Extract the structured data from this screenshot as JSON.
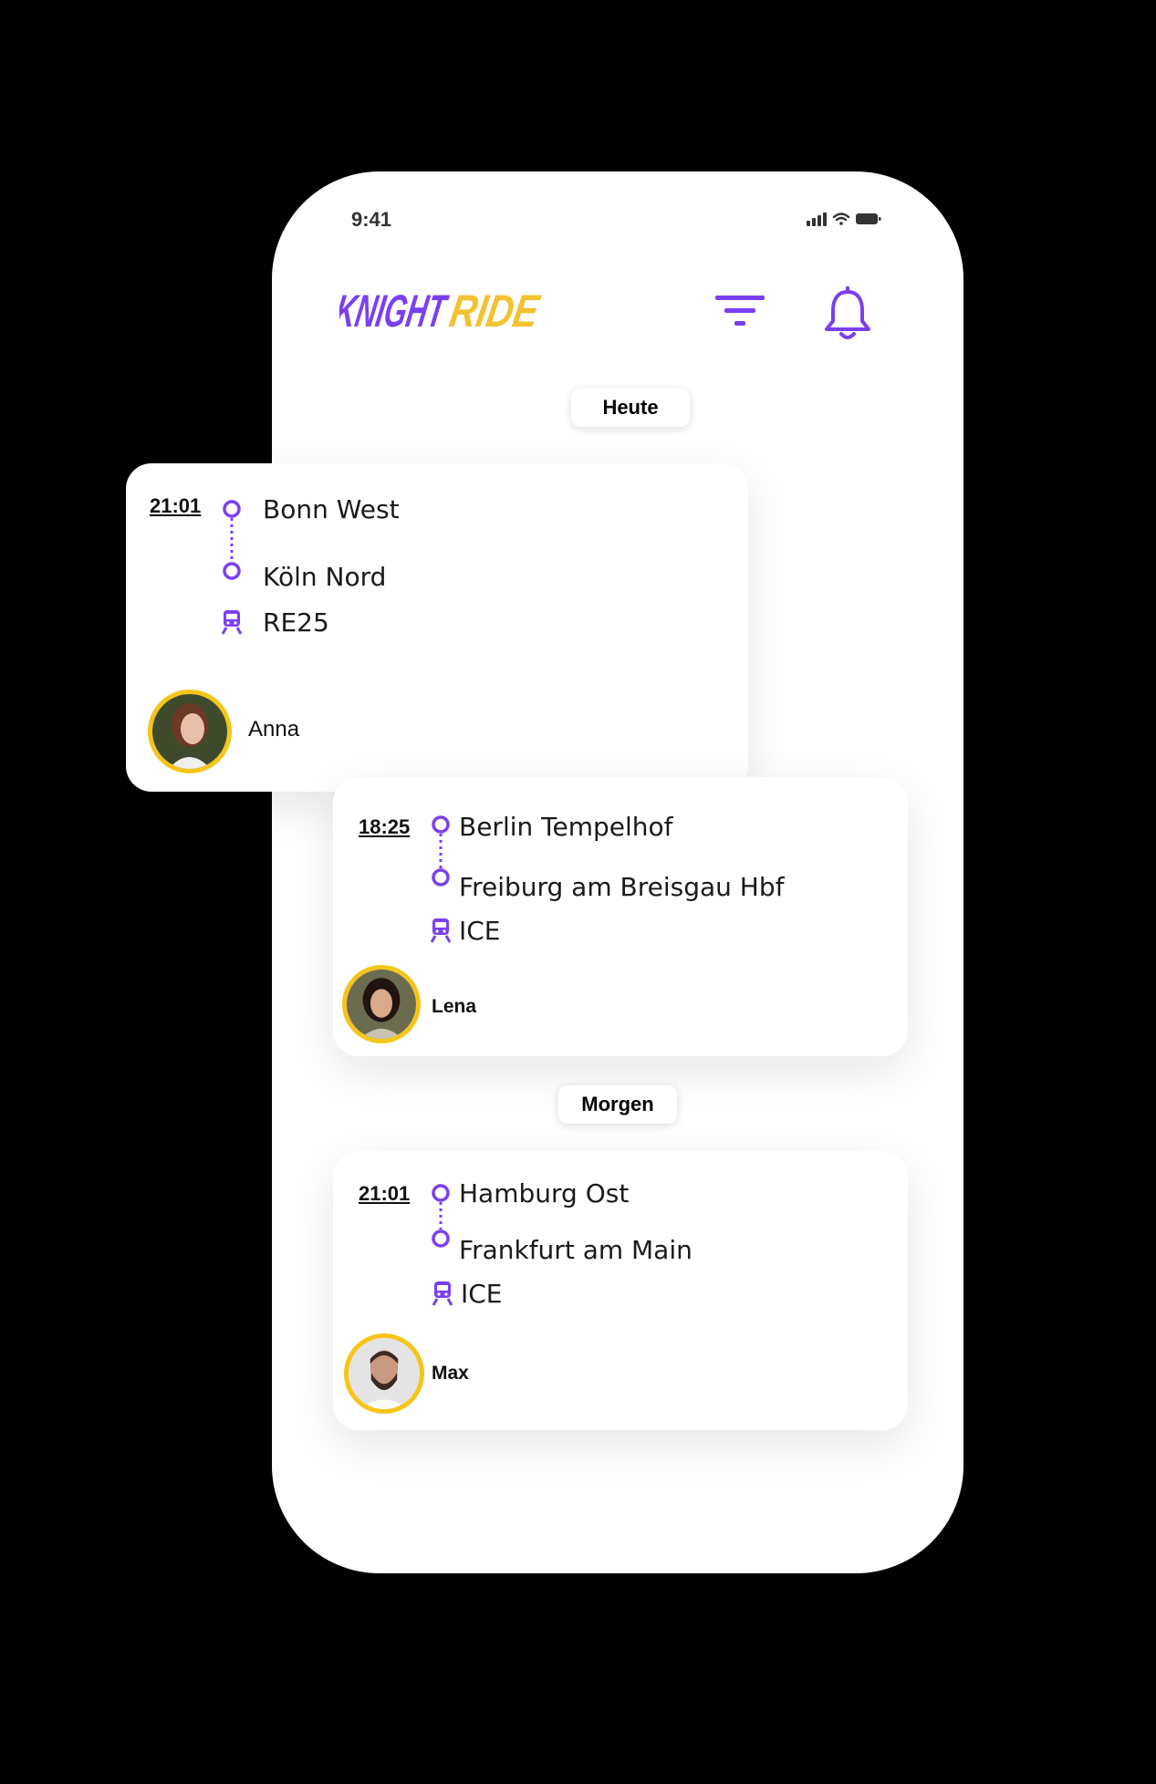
{
  "status_bar": {
    "time": "9:41"
  },
  "header": {
    "logo_text": "KNIGHTRIDE",
    "filter_icon": "filter-icon",
    "notification_icon": "bell-icon"
  },
  "colors": {
    "accent": "#7b3ff2",
    "gold": "#f5c518",
    "logo_yellow": "#f2c230"
  },
  "sections": {
    "today": "Heute",
    "tomorrow": "Morgen"
  },
  "rides": [
    {
      "time": "21:01",
      "from": "Bonn West",
      "to": "Köln Nord",
      "line": "RE25",
      "driver": "Anna"
    },
    {
      "time": "18:25",
      "from": "Berlin Tempelhof",
      "to": "Freiburg am Breisgau Hbf",
      "line": "ICE",
      "driver": "Lena"
    },
    {
      "time": "21:01",
      "from": "Hamburg Ost",
      "to": "Frankfurt am Main",
      "line": "ICE",
      "driver": "Max"
    }
  ]
}
